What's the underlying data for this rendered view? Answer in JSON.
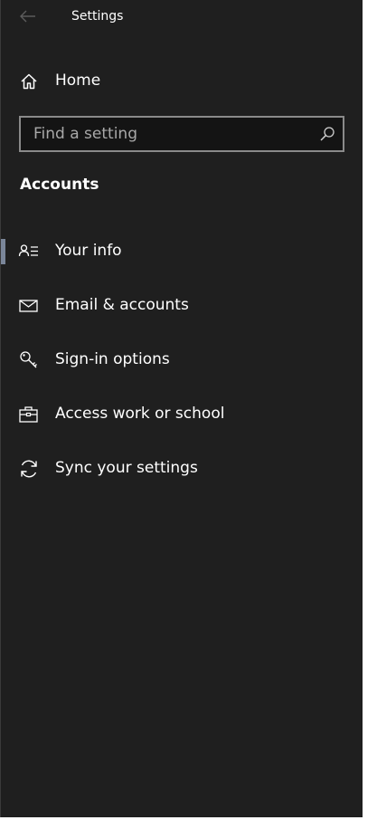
{
  "window": {
    "title": "Settings"
  },
  "nav": {
    "back_icon": "back-arrow-icon",
    "home_label": "Home",
    "home_icon": "home-icon"
  },
  "search": {
    "placeholder": "Find a setting",
    "value": "",
    "icon": "search-icon"
  },
  "section": {
    "heading": "Accounts"
  },
  "menu": {
    "selected_index": 0,
    "items": [
      {
        "label": "Your info",
        "icon": "person-card-icon"
      },
      {
        "label": "Email & accounts",
        "icon": "mail-icon"
      },
      {
        "label": "Sign-in options",
        "icon": "key-icon"
      },
      {
        "label": "Access work or school",
        "icon": "briefcase-icon"
      },
      {
        "label": "Sync your settings",
        "icon": "sync-icon"
      }
    ]
  },
  "colors": {
    "background": "#1f1f1f",
    "text": "#ffffff",
    "accent_indicator": "#7a8699",
    "search_border": "#8a8a8a",
    "muted_icon": "#5c5c5c"
  }
}
